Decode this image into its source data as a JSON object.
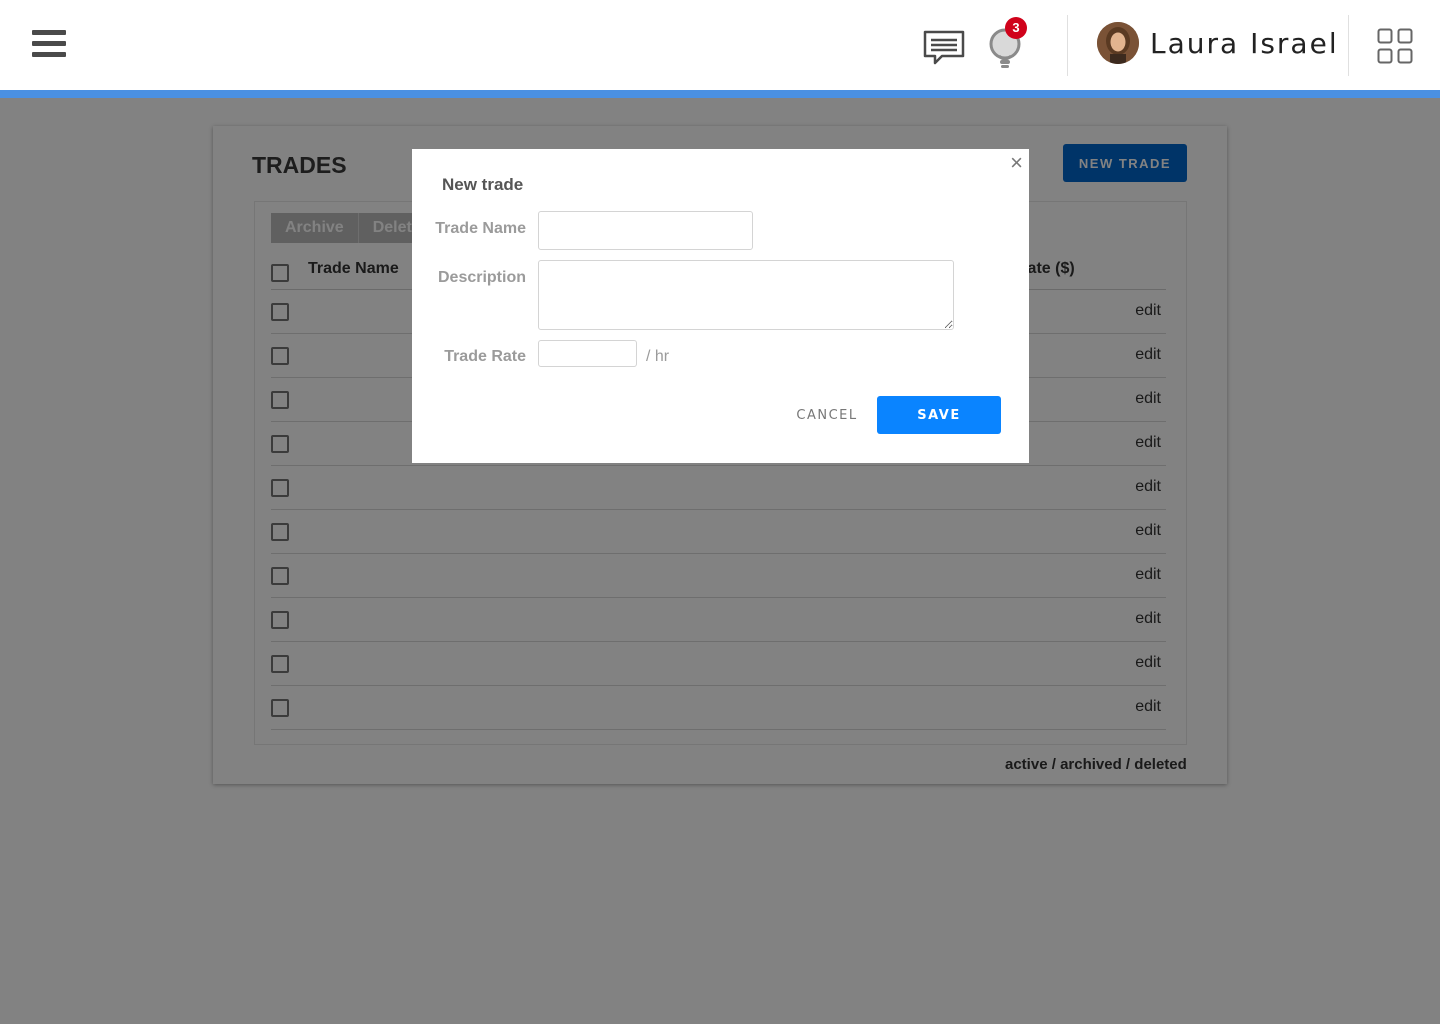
{
  "header": {
    "user_name": "Laura Israel",
    "notification_count": "3",
    "icons": [
      "hamburger-menu-icon",
      "chat-icon",
      "lightbulb-icon",
      "avatar",
      "apps-grid-icon"
    ],
    "accent_color": "#4a90e2"
  },
  "trades": {
    "title": "TRADES",
    "new_trade_label": "NEW TRADE",
    "actions": {
      "archive": "Archive",
      "delete": "Delete"
    },
    "columns": {
      "name": "Trade Name",
      "rate": "Rate ($)"
    },
    "row_action": "edit",
    "rows": [
      {
        "action": "edit"
      },
      {
        "action": "edit"
      },
      {
        "action": "edit"
      },
      {
        "action": "edit"
      },
      {
        "action": "edit"
      },
      {
        "action": "edit"
      },
      {
        "action": "edit"
      },
      {
        "action": "edit"
      },
      {
        "action": "edit"
      },
      {
        "action": "edit"
      }
    ],
    "status_filters": {
      "active": "active",
      "archived": "archived",
      "deleted": "deleted",
      "separator": " / "
    }
  },
  "modal": {
    "title": "New trade",
    "close_label": "×",
    "fields": {
      "trade_name": {
        "label": "Trade Name",
        "value": ""
      },
      "description": {
        "label": "Description",
        "value": ""
      },
      "trade_rate": {
        "label": "Trade Rate",
        "value": "",
        "unit": "/ hr"
      }
    },
    "cancel_label": "CANCEL",
    "save_label": "SAVE",
    "primary_color": "#0a84ff"
  }
}
